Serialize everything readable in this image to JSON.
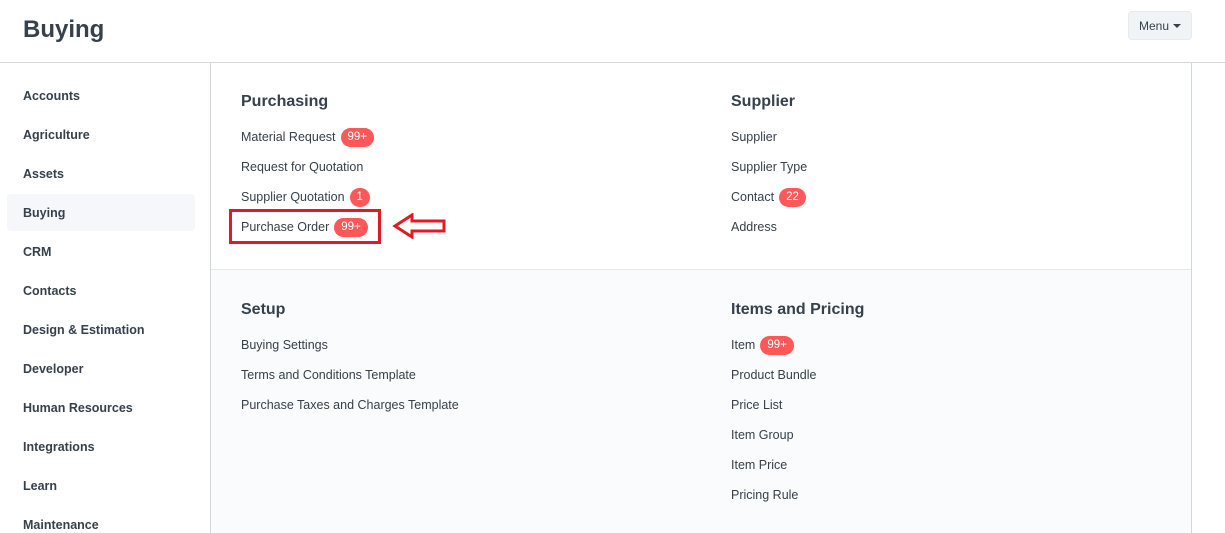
{
  "header": {
    "title": "Buying",
    "menu_label": "Menu"
  },
  "sidebar": {
    "items": [
      {
        "label": "Accounts"
      },
      {
        "label": "Agriculture"
      },
      {
        "label": "Assets"
      },
      {
        "label": "Buying",
        "active": true
      },
      {
        "label": "CRM"
      },
      {
        "label": "Contacts"
      },
      {
        "label": "Design & Estimation"
      },
      {
        "label": "Developer"
      },
      {
        "label": "Human Resources"
      },
      {
        "label": "Integrations"
      },
      {
        "label": "Learn"
      },
      {
        "label": "Maintenance"
      }
    ]
  },
  "cards": {
    "purchasing": {
      "title": "Purchasing",
      "links": [
        {
          "label": "Material Request",
          "badge": "99+"
        },
        {
          "label": "Request for Quotation"
        },
        {
          "label": "Supplier Quotation",
          "badge": "1"
        },
        {
          "label": "Purchase Order",
          "badge": "99+"
        }
      ]
    },
    "supplier": {
      "title": "Supplier",
      "links": [
        {
          "label": "Supplier"
        },
        {
          "label": "Supplier Type"
        },
        {
          "label": "Contact",
          "badge": "22"
        },
        {
          "label": "Address"
        }
      ]
    },
    "setup": {
      "title": "Setup",
      "links": [
        {
          "label": "Buying Settings"
        },
        {
          "label": "Terms and Conditions Template"
        },
        {
          "label": "Purchase Taxes and Charges Template"
        }
      ]
    },
    "items_pricing": {
      "title": "Items and Pricing",
      "links": [
        {
          "label": "Item",
          "badge": "99+"
        },
        {
          "label": "Product Bundle"
        },
        {
          "label": "Price List"
        },
        {
          "label": "Item Group"
        },
        {
          "label": "Item Price"
        },
        {
          "label": "Pricing Rule"
        }
      ]
    }
  },
  "colors": {
    "badge": "#ff5858",
    "annotation": "#e01b24",
    "text": "#36414c"
  },
  "icons": {
    "menu_caret": "caret-down-icon",
    "annotation_arrow": "arrow-left-icon"
  }
}
